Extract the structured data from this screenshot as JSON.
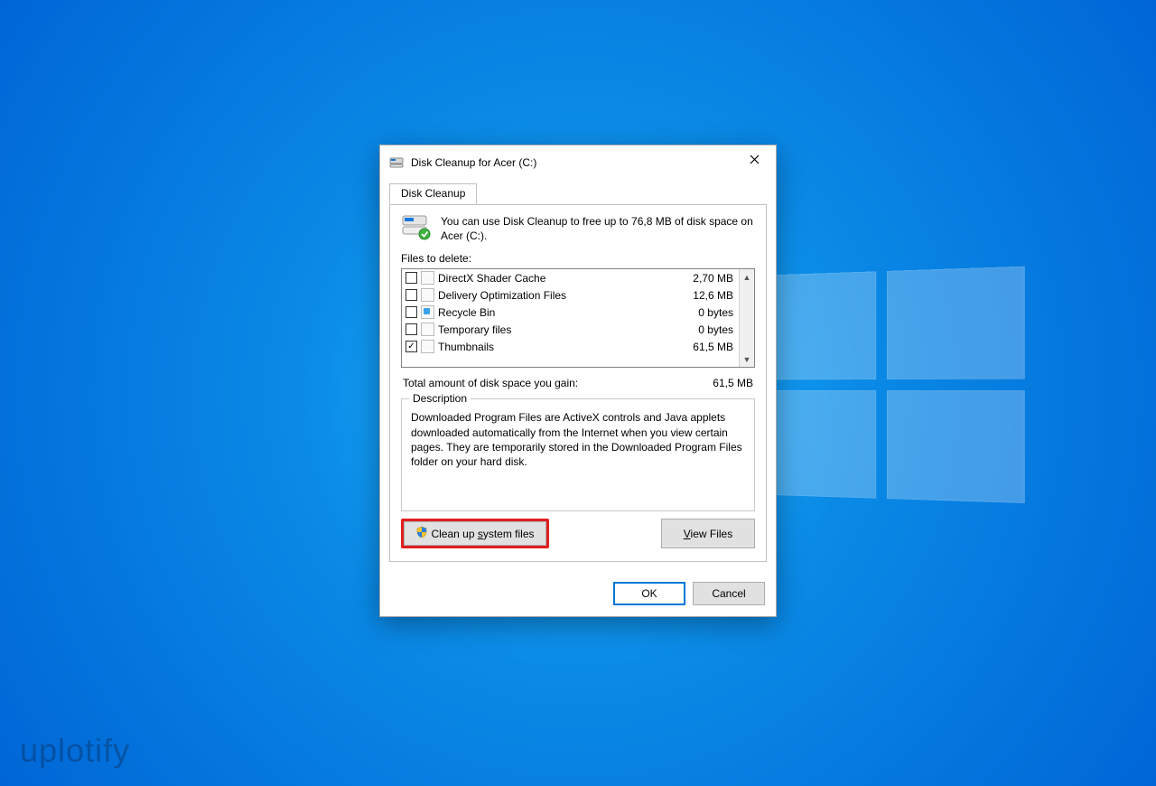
{
  "watermark": "uplotify",
  "dialog": {
    "title": "Disk Cleanup for Acer (C:)",
    "tab_label": "Disk Cleanup",
    "intro": "You can use Disk Cleanup to free up to 76,8 MB of disk space on Acer (C:).",
    "files_to_delete_label": "Files to delete:",
    "items": [
      {
        "name": "DirectX Shader Cache",
        "size": "2,70 MB",
        "checked": false,
        "icon": "file"
      },
      {
        "name": "Delivery Optimization Files",
        "size": "12,6 MB",
        "checked": false,
        "icon": "file"
      },
      {
        "name": "Recycle Bin",
        "size": "0 bytes",
        "checked": false,
        "icon": "recycle"
      },
      {
        "name": "Temporary files",
        "size": "0 bytes",
        "checked": false,
        "icon": "file"
      },
      {
        "name": "Thumbnails",
        "size": "61,5 MB",
        "checked": true,
        "icon": "file"
      }
    ],
    "total_label": "Total amount of disk space you gain:",
    "total_value": "61,5 MB",
    "description_legend": "Description",
    "description_text": "Downloaded Program Files are ActiveX controls and Java applets downloaded automatically from the Internet when you view certain pages. They are temporarily stored in the Downloaded Program Files folder on your hard disk.",
    "cleanup_system_pre": "Clean up ",
    "cleanup_system_u": "s",
    "cleanup_system_post": "ystem files",
    "view_files_u": "V",
    "view_files_post": "iew Files",
    "ok_label": "OK",
    "cancel_label": "Cancel"
  }
}
